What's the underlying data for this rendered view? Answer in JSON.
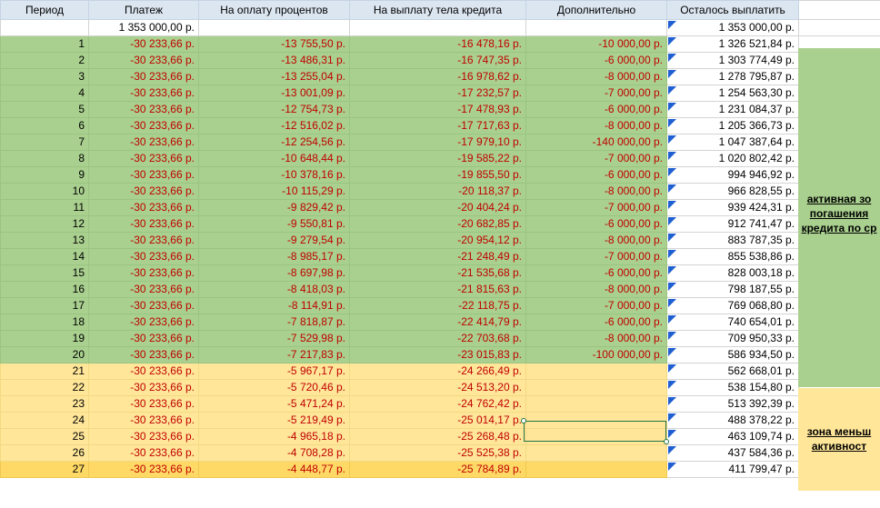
{
  "headers": [
    "Период",
    "Платеж",
    "На оплату процентов",
    "На выплату тела кредита",
    "Дополнительно",
    "Осталось выплатить"
  ],
  "initial": {
    "payment": "1 353 000,00 р.",
    "remaining": "1 353 000,00 р."
  },
  "rows": [
    {
      "period": "1",
      "payment": "-30 233,66 р.",
      "interest": "-13 755,50 р.",
      "principal": "-16 478,16 р.",
      "extra": "-10 000,00 р.",
      "remaining": "1 326 521,84 р.",
      "zone": "green"
    },
    {
      "period": "2",
      "payment": "-30 233,66 р.",
      "interest": "-13 486,31 р.",
      "principal": "-16 747,35 р.",
      "extra": "-6 000,00 р.",
      "remaining": "1 303 774,49 р.",
      "zone": "green"
    },
    {
      "period": "3",
      "payment": "-30 233,66 р.",
      "interest": "-13 255,04 р.",
      "principal": "-16 978,62 р.",
      "extra": "-8 000,00 р.",
      "remaining": "1 278 795,87 р.",
      "zone": "green"
    },
    {
      "period": "4",
      "payment": "-30 233,66 р.",
      "interest": "-13 001,09 р.",
      "principal": "-17 232,57 р.",
      "extra": "-7 000,00 р.",
      "remaining": "1 254 563,30 р.",
      "zone": "green"
    },
    {
      "period": "5",
      "payment": "-30 233,66 р.",
      "interest": "-12 754,73 р.",
      "principal": "-17 478,93 р.",
      "extra": "-6 000,00 р.",
      "remaining": "1 231 084,37 р.",
      "zone": "green"
    },
    {
      "period": "6",
      "payment": "-30 233,66 р.",
      "interest": "-12 516,02 р.",
      "principal": "-17 717,63 р.",
      "extra": "-8 000,00 р.",
      "remaining": "1 205 366,73 р.",
      "zone": "green"
    },
    {
      "period": "7",
      "payment": "-30 233,66 р.",
      "interest": "-12 254,56 р.",
      "principal": "-17 979,10 р.",
      "extra": "-140 000,00 р.",
      "remaining": "1 047 387,64 р.",
      "zone": "green"
    },
    {
      "period": "8",
      "payment": "-30 233,66 р.",
      "interest": "-10 648,44 р.",
      "principal": "-19 585,22 р.",
      "extra": "-7 000,00 р.",
      "remaining": "1 020 802,42 р.",
      "zone": "green"
    },
    {
      "period": "9",
      "payment": "-30 233,66 р.",
      "interest": "-10 378,16 р.",
      "principal": "-19 855,50 р.",
      "extra": "-6 000,00 р.",
      "remaining": "994 946,92 р.",
      "zone": "green"
    },
    {
      "period": "10",
      "payment": "-30 233,66 р.",
      "interest": "-10 115,29 р.",
      "principal": "-20 118,37 р.",
      "extra": "-8 000,00 р.",
      "remaining": "966 828,55 р.",
      "zone": "green"
    },
    {
      "period": "11",
      "payment": "-30 233,66 р.",
      "interest": "-9 829,42 р.",
      "principal": "-20 404,24 р.",
      "extra": "-7 000,00 р.",
      "remaining": "939 424,31 р.",
      "zone": "green"
    },
    {
      "period": "12",
      "payment": "-30 233,66 р.",
      "interest": "-9 550,81 р.",
      "principal": "-20 682,85 р.",
      "extra": "-6 000,00 р.",
      "remaining": "912 741,47 р.",
      "zone": "green"
    },
    {
      "period": "13",
      "payment": "-30 233,66 р.",
      "interest": "-9 279,54 р.",
      "principal": "-20 954,12 р.",
      "extra": "-8 000,00 р.",
      "remaining": "883 787,35 р.",
      "zone": "green"
    },
    {
      "period": "14",
      "payment": "-30 233,66 р.",
      "interest": "-8 985,17 р.",
      "principal": "-21 248,49 р.",
      "extra": "-7 000,00 р.",
      "remaining": "855 538,86 р.",
      "zone": "green"
    },
    {
      "period": "15",
      "payment": "-30 233,66 р.",
      "interest": "-8 697,98 р.",
      "principal": "-21 535,68 р.",
      "extra": "-6 000,00 р.",
      "remaining": "828 003,18 р.",
      "zone": "green"
    },
    {
      "period": "16",
      "payment": "-30 233,66 р.",
      "interest": "-8 418,03 р.",
      "principal": "-21 815,63 р.",
      "extra": "-8 000,00 р.",
      "remaining": "798 187,55 р.",
      "zone": "green"
    },
    {
      "period": "17",
      "payment": "-30 233,66 р.",
      "interest": "-8 114,91 р.",
      "principal": "-22 118,75 р.",
      "extra": "-7 000,00 р.",
      "remaining": "769 068,80 р.",
      "zone": "green"
    },
    {
      "period": "18",
      "payment": "-30 233,66 р.",
      "interest": "-7 818,87 р.",
      "principal": "-22 414,79 р.",
      "extra": "-6 000,00 р.",
      "remaining": "740 654,01 р.",
      "zone": "green"
    },
    {
      "period": "19",
      "payment": "-30 233,66 р.",
      "interest": "-7 529,98 р.",
      "principal": "-22 703,68 р.",
      "extra": "-8 000,00 р.",
      "remaining": "709 950,33 р.",
      "zone": "green"
    },
    {
      "period": "20",
      "payment": "-30 233,66 р.",
      "interest": "-7 217,83 р.",
      "principal": "-23 015,83 р.",
      "extra": "-100 000,00 р.",
      "remaining": "586 934,50 р.",
      "zone": "green"
    },
    {
      "period": "21",
      "payment": "-30 233,66 р.",
      "interest": "-5 967,17 р.",
      "principal": "-24 266,49 р.",
      "extra": "",
      "remaining": "562 668,01 р.",
      "zone": "yellow"
    },
    {
      "period": "22",
      "payment": "-30 233,66 р.",
      "interest": "-5 720,46 р.",
      "principal": "-24 513,20 р.",
      "extra": "",
      "remaining": "538 154,80 р.",
      "zone": "yellow"
    },
    {
      "period": "23",
      "payment": "-30 233,66 р.",
      "interest": "-5 471,24 р.",
      "principal": "-24 762,42 р.",
      "extra": "",
      "remaining": "513 392,39 р.",
      "zone": "yellow"
    },
    {
      "period": "24",
      "payment": "-30 233,66 р.",
      "interest": "-5 219,49 р.",
      "principal": "-25 014,17 р.",
      "extra": "",
      "remaining": "488 378,22 р.",
      "zone": "yellow"
    },
    {
      "period": "25",
      "payment": "-30 233,66 р.",
      "interest": "-4 965,18 р.",
      "principal": "-25 268,48 р.",
      "extra": "",
      "remaining": "463 109,74 р.",
      "zone": "yellow"
    },
    {
      "period": "26",
      "payment": "-30 233,66 р.",
      "interest": "-4 708,28 р.",
      "principal": "-25 525,38 р.",
      "extra": "",
      "remaining": "437 584,36 р.",
      "zone": "yellow"
    },
    {
      "period": "27",
      "payment": "-30 233,66 р.",
      "interest": "-4 448,77 р.",
      "principal": "-25 784,89 р.",
      "extra": "",
      "remaining": "411 799,47 р.",
      "zone": "orange"
    }
  ],
  "zones": {
    "active": [
      "активная зо",
      "погашения",
      "кредита по ср"
    ],
    "lower": [
      "зона меньш",
      "активност"
    ]
  },
  "colors": {
    "green": "#a9d08e",
    "yellow": "#ffe699",
    "orange": "#ffd966",
    "negative_text": "#c00000",
    "header": "#dce6f1"
  }
}
